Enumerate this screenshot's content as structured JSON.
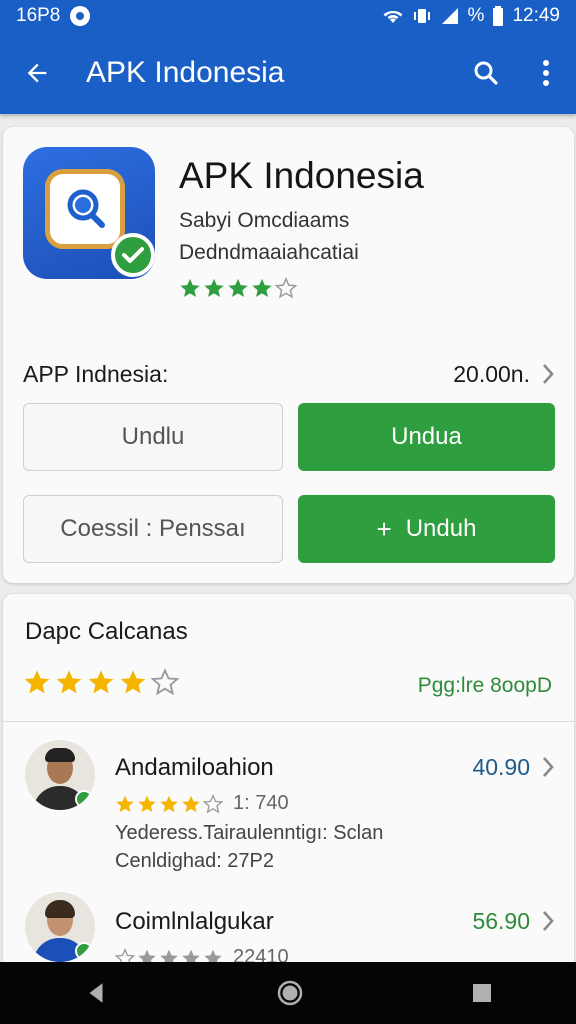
{
  "status_bar": {
    "left_text": "16P8",
    "time": "12:49"
  },
  "app_bar": {
    "title": "APK Indonesia"
  },
  "app": {
    "name": "APK Indonesia",
    "line1": "Sabyi Omcdiaams",
    "line2": "Dedndmaaiahcatiai",
    "rating_stars": 4
  },
  "info_row": {
    "label": "APP Indnesia:",
    "value": "20.00n."
  },
  "buttons": {
    "b1": "Undlu",
    "b2": "Undua",
    "b3": "Coessil : Penssaı",
    "b4_icon": "+",
    "b4": "Unduh"
  },
  "reviews": {
    "title": "Dapc Calcanas",
    "overall_stars": 4,
    "link": "Pgg:lre 8oopD",
    "items": [
      {
        "name": "Andamiloahion",
        "score": "40.90",
        "stars": 4,
        "count": "1: 740",
        "line1": "Yederess.Tairaulenntigı: Sclan",
        "line2": "Cenldighad: 27P2"
      },
      {
        "name": "Coimlnlalgukar",
        "score": "56.90",
        "stars": 0,
        "count": "22410"
      }
    ]
  },
  "colors": {
    "primary": "#1a5fc6",
    "green": "#2e9e3e",
    "star_gold": "#f5b400",
    "score_blue": "#1e5a8c"
  }
}
